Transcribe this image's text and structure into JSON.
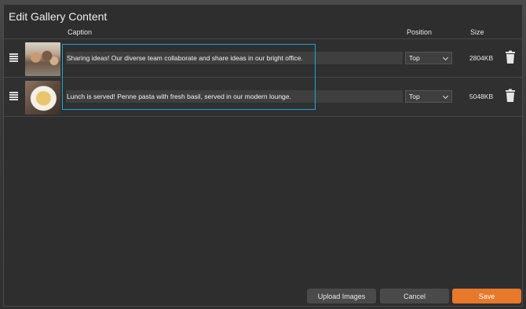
{
  "dialog": {
    "title": "Edit Gallery Content"
  },
  "columns": {
    "caption": "Caption",
    "position": "Position",
    "size": "Size"
  },
  "rows": [
    {
      "caption": "Sharing ideas! Our diverse team collaborate and share ideas in our bright office.",
      "position": "Top",
      "size": "2804KB"
    },
    {
      "caption": "Lunch is served! Penne pasta with fresh basil, served in our modern lounge.",
      "position": "Top",
      "size": "5048KB"
    }
  ],
  "buttons": {
    "upload": "Upload Images",
    "cancel": "Cancel",
    "save": "Save"
  },
  "colors": {
    "accent": "#e8782a",
    "highlight": "#1aa7d8",
    "dialog_bg": "#2e2e2e"
  }
}
